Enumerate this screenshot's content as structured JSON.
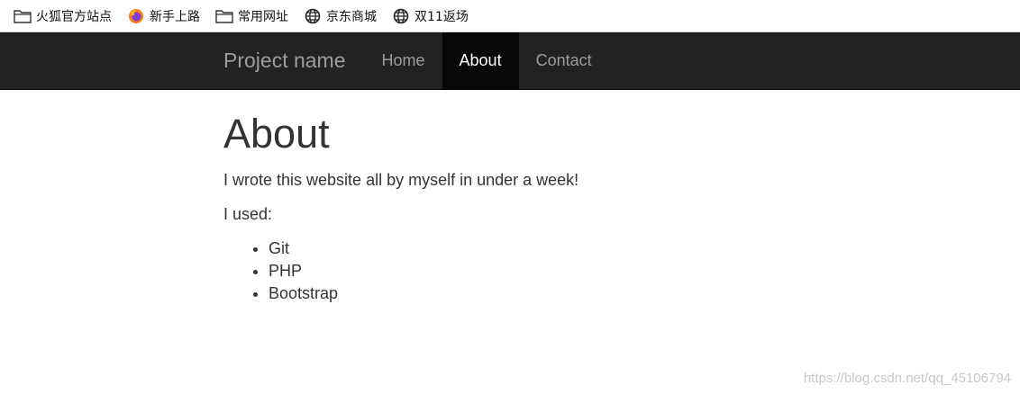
{
  "bookmarks": [
    {
      "label": "火狐官方站点",
      "icon": "folder-icon"
    },
    {
      "label": "新手上路",
      "icon": "firefox-icon"
    },
    {
      "label": "常用网址",
      "icon": "folder-icon"
    },
    {
      "label": "京东商城",
      "icon": "globe-icon"
    },
    {
      "label": "双11返场",
      "icon": "globe-icon"
    }
  ],
  "navbar": {
    "brand": "Project name",
    "items": [
      {
        "label": "Home",
        "active": false
      },
      {
        "label": "About",
        "active": true
      },
      {
        "label": "Contact",
        "active": false
      }
    ],
    "background": "#222222",
    "active_background": "#080808"
  },
  "main": {
    "title": "About",
    "intro": "I wrote this website all by myself in under a week!",
    "used_label": "I used:",
    "tools": [
      "Git",
      "PHP",
      "Bootstrap"
    ]
  },
  "watermark": "https://blog.csdn.net/qq_45106794"
}
